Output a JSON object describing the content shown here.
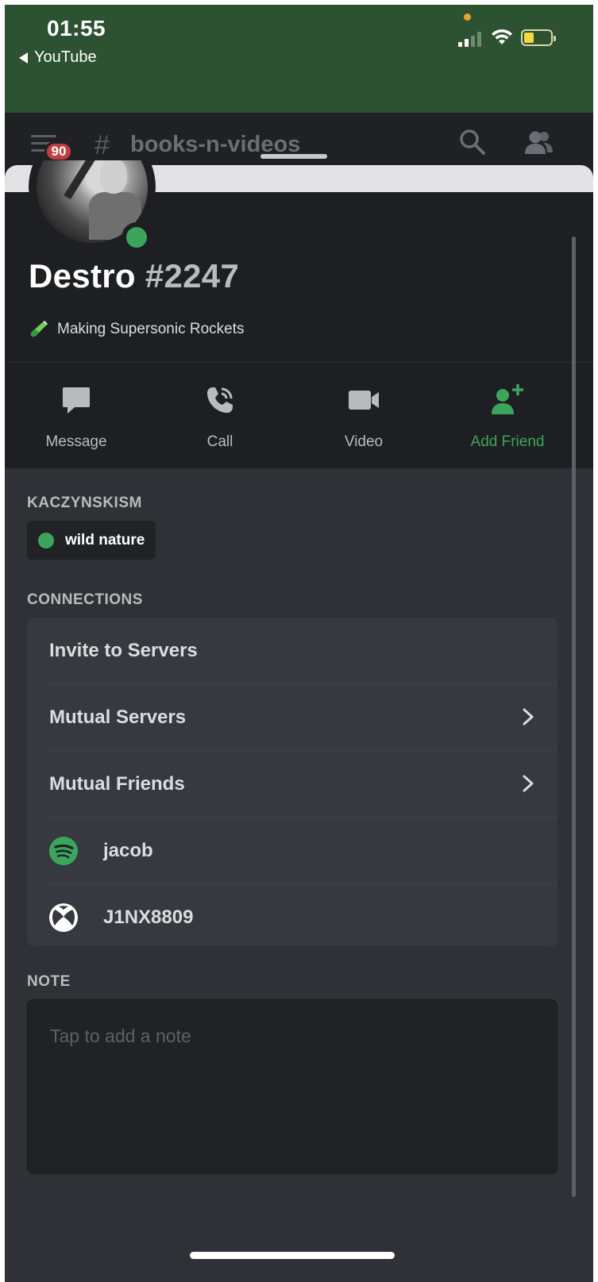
{
  "status_bar": {
    "time": "01:55",
    "back_app": "YouTube",
    "colors": {
      "background": "#2d5232",
      "battery_fill": "#f5d742",
      "privacy_dot": "#f0a030"
    }
  },
  "channel_header": {
    "unread_badge": "90",
    "hash": "#",
    "channel_name": "books-n-videos",
    "icons": [
      "hamburger-menu-icon",
      "search-icon",
      "members-icon"
    ]
  },
  "profile": {
    "username": "Destro",
    "discriminator": "#2247",
    "custom_status": "Making Supersonic Rockets",
    "presence": "online",
    "presence_color": "#3ba55c"
  },
  "actions": [
    {
      "label": "Message",
      "icon": "message-icon"
    },
    {
      "label": "Call",
      "icon": "call-icon"
    },
    {
      "label": "Video",
      "icon": "video-icon"
    },
    {
      "label": "Add Friend",
      "icon": "add-friend-icon"
    }
  ],
  "roles_section": {
    "title": "KACZYNSKISM",
    "roles": [
      {
        "name": "wild nature",
        "color": "#3ba55c"
      }
    ]
  },
  "connections_section": {
    "title": "CONNECTIONS",
    "rows": [
      {
        "label": "Invite to Servers"
      },
      {
        "label": "Mutual Servers",
        "chevron": true
      },
      {
        "label": "Mutual Friends",
        "chevron": true
      },
      {
        "label": "jacob",
        "icon": "spotify-icon"
      },
      {
        "label": "J1NX8809",
        "icon": "xbox-icon"
      }
    ]
  },
  "note_section": {
    "title": "NOTE",
    "placeholder": "Tap to add a note"
  },
  "theme": {
    "sheet_background": "#2f3136",
    "header_background": "#1e1f22",
    "card_background": "#36393f",
    "accent_green": "#3ba55c"
  }
}
